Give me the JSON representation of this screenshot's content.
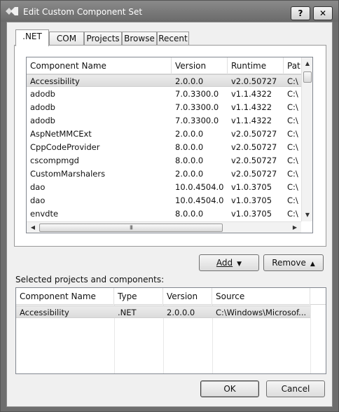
{
  "window": {
    "title": "Edit Custom Component Set",
    "help_label": "?",
    "close_label": "✕"
  },
  "tabs": [
    {
      "label": ".NET",
      "active": true
    },
    {
      "label": "COM",
      "active": false
    },
    {
      "label": "Projects",
      "active": false
    },
    {
      "label": "Browse",
      "active": false
    },
    {
      "label": "Recent",
      "active": false
    }
  ],
  "components": {
    "columns": [
      "Component Name",
      "Version",
      "Runtime",
      "Path"
    ],
    "columns_visible": [
      "Component Name",
      "Version",
      "Runtime",
      "Pat"
    ],
    "rows": [
      [
        "Accessibility",
        "2.0.0.0",
        "v2.0.50727",
        "C:\\"
      ],
      [
        "adodb",
        "7.0.3300.0",
        "v1.1.4322",
        "C:\\"
      ],
      [
        "adodb",
        "7.0.3300.0",
        "v1.1.4322",
        "C:\\"
      ],
      [
        "adodb",
        "7.0.3300.0",
        "v1.1.4322",
        "C:\\"
      ],
      [
        "AspNetMMCExt",
        "2.0.0.0",
        "v2.0.50727",
        "C:\\"
      ],
      [
        "CppCodeProvider",
        "8.0.0.0",
        "v2.0.50727",
        "C:\\"
      ],
      [
        "cscompmgd",
        "8.0.0.0",
        "v2.0.50727",
        "C:\\"
      ],
      [
        "CustomMarshalers",
        "2.0.0.0",
        "v2.0.50727",
        "C:\\"
      ],
      [
        "dao",
        "10.0.4504.0",
        "v1.0.3705",
        "C:\\"
      ],
      [
        "dao",
        "10.0.4504.0",
        "v1.0.3705",
        "C:\\"
      ],
      [
        "envdte",
        "8.0.0.0",
        "v1.0.3705",
        "C:\\"
      ]
    ],
    "selected_index": 0,
    "hscroll_grip": "III"
  },
  "actions": {
    "add_label": "Add",
    "remove_label": "Remove"
  },
  "selected": {
    "label": "Selected projects and components:",
    "columns": [
      "Component Name",
      "Type",
      "Version",
      "Source"
    ],
    "rows": [
      [
        "Accessibility",
        ".NET",
        "2.0.0.0",
        "C:\\Windows\\Microsof..."
      ]
    ]
  },
  "footer": {
    "ok_label": "OK",
    "cancel_label": "Cancel"
  }
}
